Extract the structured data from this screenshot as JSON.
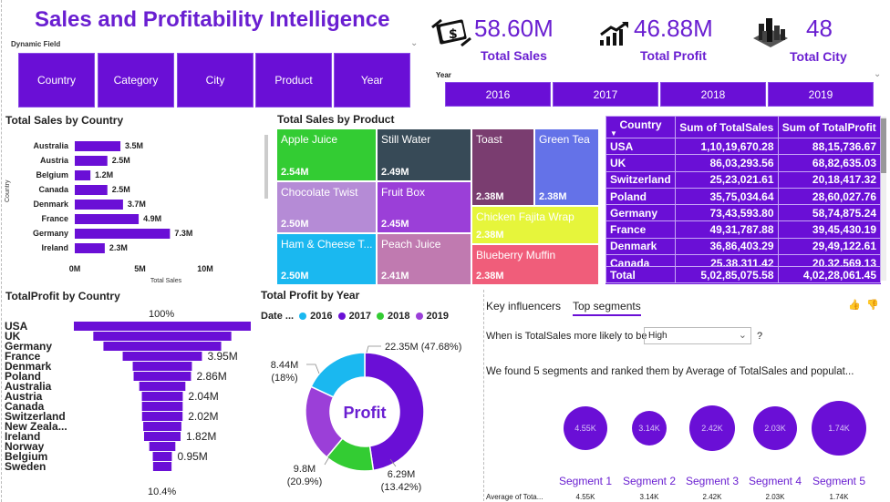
{
  "header": {
    "title": "Sales and Profitability Intelligence",
    "dynamic_field_label": "Dynamic Field",
    "year_label": "Year"
  },
  "dynamic_field_buttons": [
    "Country",
    "Category",
    "City",
    "Product",
    "Year"
  ],
  "year_buttons": [
    "2016",
    "2017",
    "2018",
    "2019"
  ],
  "kpis": [
    {
      "value": "58.60M",
      "label": "Total Sales",
      "icon": "money-icon"
    },
    {
      "value": "46.88M",
      "label": "Total Profit",
      "icon": "growth-chart-icon"
    },
    {
      "value": "48",
      "label": "Total City",
      "icon": "city-icon"
    }
  ],
  "sales_by_country": {
    "title": "Total Sales by Country",
    "ylabel": "Country",
    "xlabel": "Total Sales",
    "ticks": [
      "0M",
      "5M",
      "10M"
    ],
    "categories": [
      "Australia",
      "Austria",
      "Belgium",
      "Canada",
      "Denmark",
      "France",
      "Germany",
      "Ireland"
    ],
    "values": [
      3.5,
      2.5,
      1.2,
      2.5,
      3.7,
      4.9,
      7.3,
      2.3
    ],
    "labels": [
      "3.5M",
      "2.5M",
      "1.2M",
      "2.5M",
      "3.7M",
      "4.9M",
      "7.3M",
      "2.3M"
    ],
    "xlim": [
      0,
      10
    ]
  },
  "sales_by_product": {
    "title": "Total Sales by Product",
    "items": [
      {
        "name": "Apple Juice",
        "value": "2.54M",
        "color": "#33cc33"
      },
      {
        "name": "Still Water",
        "value": "2.49M",
        "color": "#374a57"
      },
      {
        "name": "Toast",
        "value": "2.38M",
        "color": "#7a3d70"
      },
      {
        "name": "Green Tea",
        "value": "2.38M",
        "color": "#6472e8"
      },
      {
        "name": "Chocolate Twist",
        "value": "2.50M",
        "color": "#b58bd6"
      },
      {
        "name": "Fruit Box",
        "value": "2.45M",
        "color": "#9b3fd8"
      },
      {
        "name": "Chicken Fajita Wrap",
        "value": "2.38M",
        "color": "#e6f53b"
      },
      {
        "name": "Ham & Cheese T...",
        "value": "2.50M",
        "color": "#1ab8f0"
      },
      {
        "name": "Peach Juice",
        "value": "2.41M",
        "color": "#c07ab0"
      },
      {
        "name": "Blueberry Muffin",
        "value": "2.38M",
        "color": "#f05d7a"
      }
    ]
  },
  "matrix": {
    "headers": [
      "Country",
      "Sum of TotalSales",
      "Sum of TotalProfit"
    ],
    "rows": [
      [
        "USA",
        "1,10,19,670.28",
        "88,15,736.67"
      ],
      [
        "UK",
        "86,03,293.56",
        "68,82,635.03"
      ],
      [
        "Switzerland",
        "25,23,021.61",
        "20,18,417.32"
      ],
      [
        "Poland",
        "35,75,034.64",
        "28,60,027.76"
      ],
      [
        "Germany",
        "73,43,593.80",
        "58,74,875.24"
      ],
      [
        "France",
        "49,31,787.88",
        "39,45,430.19"
      ],
      [
        "Denmark",
        "36,86,403.29",
        "29,49,122.61"
      ],
      [
        "Canada",
        "25,38,311.42",
        "20,32,569.13"
      ]
    ],
    "total": [
      "Total",
      "5,02,85,075.58",
      "4,02,28,061.45"
    ]
  },
  "profit_by_country": {
    "title": "TotalProfit by Country",
    "top_pct": "100%",
    "bottom_pct": "10.4%",
    "countries": [
      "USA",
      "UK",
      "Germany",
      "France",
      "Denmark",
      "Poland",
      "Australia",
      "Austria",
      "Canada",
      "Switzerland",
      "New Zeala...",
      "Ireland",
      "Norway",
      "Belgium",
      "Sweden"
    ],
    "values": [
      8.82,
      6.88,
      5.87,
      3.95,
      2.95,
      2.86,
      2.3,
      2.04,
      2.03,
      2.02,
      1.9,
      1.82,
      1.3,
      0.95,
      0.92
    ],
    "labels": [
      "",
      "",
      "",
      "3.95M",
      "",
      "2.86M",
      "",
      "2.04M",
      "",
      "2.02M",
      "",
      "1.82M",
      "",
      "0.95M",
      ""
    ]
  },
  "profit_by_year": {
    "title": "Total Profit by Year",
    "legend_title": "Date ...",
    "center_label": "Profit",
    "slices": [
      {
        "year": "2016",
        "value": 8.44,
        "label": "8.44M",
        "pct": "(18%)",
        "color": "#1ab8f0"
      },
      {
        "year": "2017",
        "value": 22.35,
        "label": "22.35M (47.68%)",
        "pct": "",
        "color": "#6a0fd6"
      },
      {
        "year": "2018",
        "value": 6.29,
        "label": "6.29M",
        "pct": "(13.42%)",
        "color": "#33cc33"
      },
      {
        "year": "2019",
        "value": 9.8,
        "label": "9.8M",
        "pct": "(20.9%)",
        "color": "#9b3fd8"
      }
    ]
  },
  "influencers": {
    "tab1": "Key influencers",
    "tab2": "Top segments",
    "question": "When is TotalSales more likely to be",
    "select_value": "High",
    "help": "?",
    "summary": "We found 5 segments and ranked them by Average of TotalSales and populat...",
    "avg_label": "Average of Tota...",
    "segments": [
      {
        "name": "Segment 1",
        "value": "4.55K"
      },
      {
        "name": "Segment 2",
        "value": "3.14K"
      },
      {
        "name": "Segment 3",
        "value": "2.42K"
      },
      {
        "name": "Segment 4",
        "value": "2.03K"
      },
      {
        "name": "Segment 5",
        "value": "1.74K"
      }
    ]
  }
}
